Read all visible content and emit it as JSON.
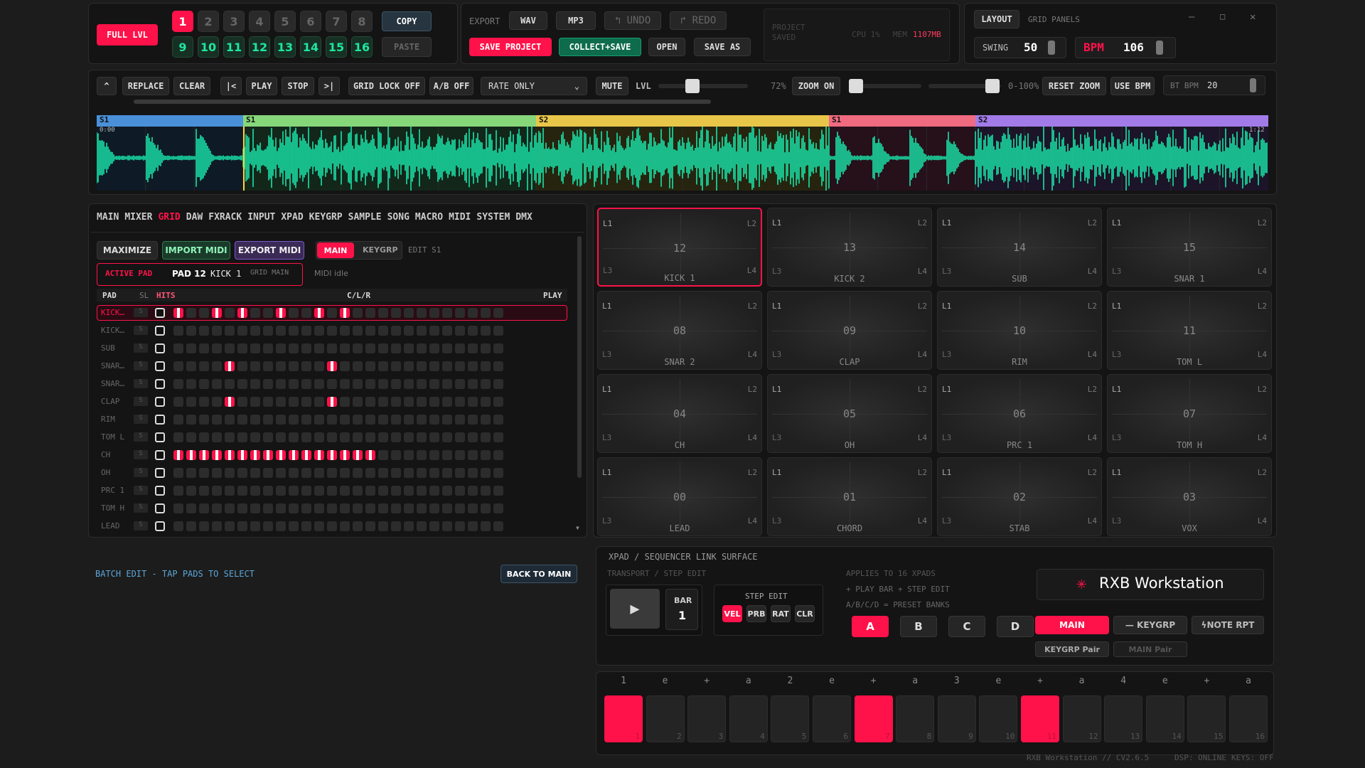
{
  "top": {
    "full_lvl": "FULL LVL",
    "nums_row1": [
      "1",
      "2",
      "3",
      "4",
      "5",
      "6",
      "7",
      "8"
    ],
    "nums_row2": [
      "9",
      "10",
      "11",
      "12",
      "13",
      "14",
      "15",
      "16"
    ],
    "copy": "COPY",
    "paste": "PASTE"
  },
  "export": {
    "label": "EXPORT",
    "wav": "WAV",
    "mp3": "MP3",
    "undo": "UNDO",
    "redo": "REDO",
    "save_project": "SAVE PROJECT",
    "collect_save": "COLLECT+SAVE",
    "open": "OPEN",
    "save_as": "SAVE AS",
    "project_saved": "PROJECT SAVED",
    "cpu": "CPU 1%",
    "mem_label": "MEM",
    "mem_value": "1107MB"
  },
  "layout": {
    "label": "LAYOUT",
    "grid_panels": "GRID PANELS",
    "swing_label": "SWING",
    "swing_value": "50",
    "bpm_label": "BPM",
    "bpm_value": "106"
  },
  "transport": {
    "replace": "REPLACE",
    "clear": "CLEAR",
    "start": "|<",
    "play": "PLAY",
    "stop": "STOP",
    "end": ">|",
    "grid_lock": "GRID LOCK OFF",
    "ab": "A/B OFF",
    "rate": "RATE ONLY",
    "mute": "MUTE",
    "lvl": "LVL",
    "pct": "72%",
    "zoom_on": "ZOOM ON",
    "range": "0-100%",
    "reset_zoom": "RESET ZOOM",
    "use_bpm": "USE BPM",
    "bt_bpm": "BT BPM",
    "bt_value": "20"
  },
  "waveform": {
    "segments": [
      {
        "label": "S1",
        "color": "#4a90d9",
        "frac": 0.125
      },
      {
        "label": "S1",
        "color": "#86d77a",
        "frac": 0.25
      },
      {
        "label": "S2",
        "color": "#e8c64a",
        "frac": 0.25
      },
      {
        "label": "S1",
        "color": "#f06a80",
        "frac": 0.125
      },
      {
        "label": "S2",
        "color": "#a27be8",
        "frac": 0.25
      }
    ],
    "start_time": "0:00",
    "end_time": "1:12",
    "wave_color": "#19e3a8"
  },
  "nav": {
    "tabs": [
      "MAIN",
      "MIXER",
      "GRID",
      "DAW",
      "FXRACK",
      "INPUT",
      "XPAD",
      "KEYGRP",
      "SAMPLE",
      "SONG",
      "MACRO",
      "MIDI",
      "SYSTEM",
      "DMX"
    ],
    "active": "GRID"
  },
  "grid": {
    "maximize": "MAXIMIZE",
    "import_midi": "IMPORT MIDI",
    "export_midi": "EXPORT MIDI",
    "main": "MAIN",
    "keygrp": "KEYGRP",
    "edit": "EDIT S1",
    "active_pad_label": "ACTIVE PAD",
    "active_pad": "PAD 12",
    "active_name": "KICK 1",
    "grid_main": "GRID MAIN",
    "midi_idle": "MIDI idle",
    "col_pad": "PAD",
    "col_sl": "SL",
    "col_hits": "HITS",
    "col_clr": "C/L/R",
    "col_play": "PLAY",
    "sl_text": "S",
    "rows": [
      {
        "name": "KICK…",
        "hits": [
          1,
          4,
          6,
          9,
          12,
          14
        ]
      },
      {
        "name": "KICK…",
        "hits": []
      },
      {
        "name": "SUB",
        "hits": []
      },
      {
        "name": "SNAR…",
        "hits": [
          5,
          13
        ]
      },
      {
        "name": "SNAR…",
        "hits": []
      },
      {
        "name": "CLAP",
        "hits": [
          5,
          13
        ]
      },
      {
        "name": "RIM",
        "hits": []
      },
      {
        "name": "TOM L",
        "hits": []
      },
      {
        "name": "CH",
        "hits": [
          1,
          2,
          3,
          4,
          5,
          6,
          7,
          8,
          9,
          10,
          11,
          12,
          13,
          14,
          15,
          16
        ]
      },
      {
        "name": "OH",
        "hits": []
      },
      {
        "name": "PRC 1",
        "hits": []
      },
      {
        "name": "TOM H",
        "hits": []
      },
      {
        "name": "LEAD",
        "hits": []
      }
    ]
  },
  "batch": {
    "text": "BATCH EDIT - TAP PADS TO SELECT",
    "back": "BACK TO MAIN"
  },
  "pads": [
    {
      "n": "12",
      "name": "KICK 1"
    },
    {
      "n": "13",
      "name": "KICK 2"
    },
    {
      "n": "14",
      "name": "SUB"
    },
    {
      "n": "15",
      "name": "SNAR 1"
    },
    {
      "n": "08",
      "name": "SNAR 2"
    },
    {
      "n": "09",
      "name": "CLAP"
    },
    {
      "n": "10",
      "name": "RIM"
    },
    {
      "n": "11",
      "name": "TOM L"
    },
    {
      "n": "04",
      "name": "CH"
    },
    {
      "n": "05",
      "name": "OH"
    },
    {
      "n": "06",
      "name": "PRC 1"
    },
    {
      "n": "07",
      "name": "TOM H"
    },
    {
      "n": "00",
      "name": "LEAD"
    },
    {
      "n": "01",
      "name": "CHORD"
    },
    {
      "n": "02",
      "name": "STAB"
    },
    {
      "n": "03",
      "name": "VOX"
    }
  ],
  "pad_corners": {
    "l1": "L1",
    "l2": "L2",
    "l3": "L3",
    "l4": "L4"
  },
  "xpad": {
    "title": "XPAD / SEQUENCER LINK SURFACE",
    "sub": "TRANSPORT / STEP EDIT",
    "bar_label": "BAR",
    "bar_value": "1",
    "step_edit": "STEP EDIT",
    "vel": "VEL",
    "prb": "PRB",
    "rat": "RAT",
    "clr": "CLR",
    "info1": "APPLIES TO 16 XPADS",
    "info2": "+ PLAY BAR + STEP EDIT",
    "info3": "A/B/C/D = PRESET BANKS",
    "banks": [
      "A",
      "B",
      "C",
      "D"
    ],
    "brand": "RXB Workstation",
    "main": "MAIN",
    "keygrp": "KEYGRP",
    "note_rpt": "NOTE RPT",
    "keygrp_pair": "KEYGRP Pair",
    "main_pair": "MAIN Pair"
  },
  "steps": {
    "labels": [
      "1",
      "e",
      "+",
      "a",
      "2",
      "e",
      "+",
      "a",
      "3",
      "e",
      "+",
      "a",
      "4",
      "e",
      "+",
      "a"
    ],
    "on": [
      1,
      7,
      11
    ]
  },
  "footer": {
    "version": "RXB Workstation // CV2.6.5",
    "dsp": "DSP: ONLINE",
    "keys": "KEYS: OFF"
  }
}
